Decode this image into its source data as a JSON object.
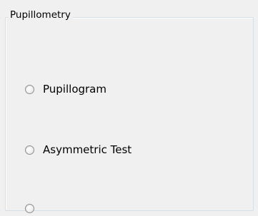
{
  "groupbox": {
    "title": "Pupillometry"
  },
  "options": [
    {
      "label": "Pupillogram",
      "selected": false
    },
    {
      "label": "Asymmetric Test",
      "selected": false
    },
    {
      "label": "",
      "selected": false
    }
  ]
}
